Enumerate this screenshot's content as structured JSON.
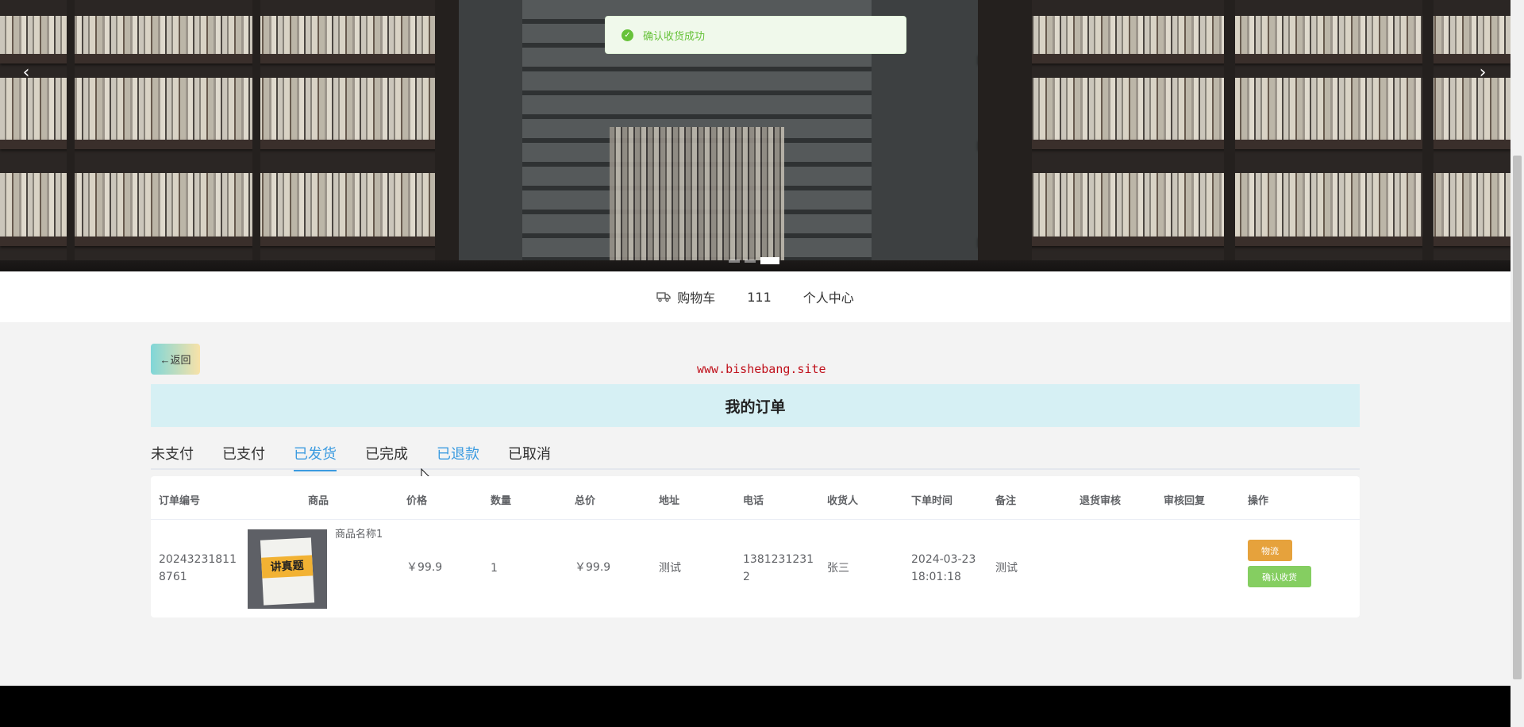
{
  "toast": {
    "message": "确认收货成功",
    "icon": "check-circle-icon",
    "color": "#67c23a"
  },
  "carousel": {
    "prev_icon": "chevron-left-icon",
    "next_icon": "chevron-right-icon",
    "slide_count": 3,
    "active_slide": 3
  },
  "navbar": {
    "items": [
      {
        "label": "购物车",
        "icon": "truck-icon"
      },
      {
        "label": "111"
      },
      {
        "label": "个人中心"
      }
    ]
  },
  "main": {
    "back_label": "←返回",
    "watermark": "www.bishebang.site",
    "title": "我的订单",
    "tabs": [
      {
        "label": "未支付",
        "state": "default"
      },
      {
        "label": "已支付",
        "state": "default"
      },
      {
        "label": "已发货",
        "state": "active"
      },
      {
        "label": "已完成",
        "state": "default"
      },
      {
        "label": "已退款",
        "state": "hover"
      },
      {
        "label": "已取消",
        "state": "default"
      }
    ],
    "accent_color": "#3b9be0"
  },
  "table": {
    "headers": [
      "订单编号",
      "商品",
      "价格",
      "数量",
      "总价",
      "地址",
      "电话",
      "收货人",
      "下单时间",
      "备注",
      "退货审核",
      "审核回复",
      "操作"
    ],
    "rows": [
      {
        "order_no_line1": "20243231811",
        "order_no_line2": "8761",
        "product_name": "商品名称1",
        "product_cover_text": "讲真题",
        "price": "￥99.9",
        "quantity": "1",
        "total": "￥99.9",
        "address": "测试",
        "phone_line1": "1381231231",
        "phone_line2": "2",
        "receiver": "张三",
        "order_time_line1": "2024-03-23",
        "order_time_line2": "18:01:18",
        "remark": "测试",
        "return_review": "",
        "review_reply": "",
        "actions": {
          "logistics": "物流",
          "confirm": "确认收货"
        }
      }
    ]
  }
}
